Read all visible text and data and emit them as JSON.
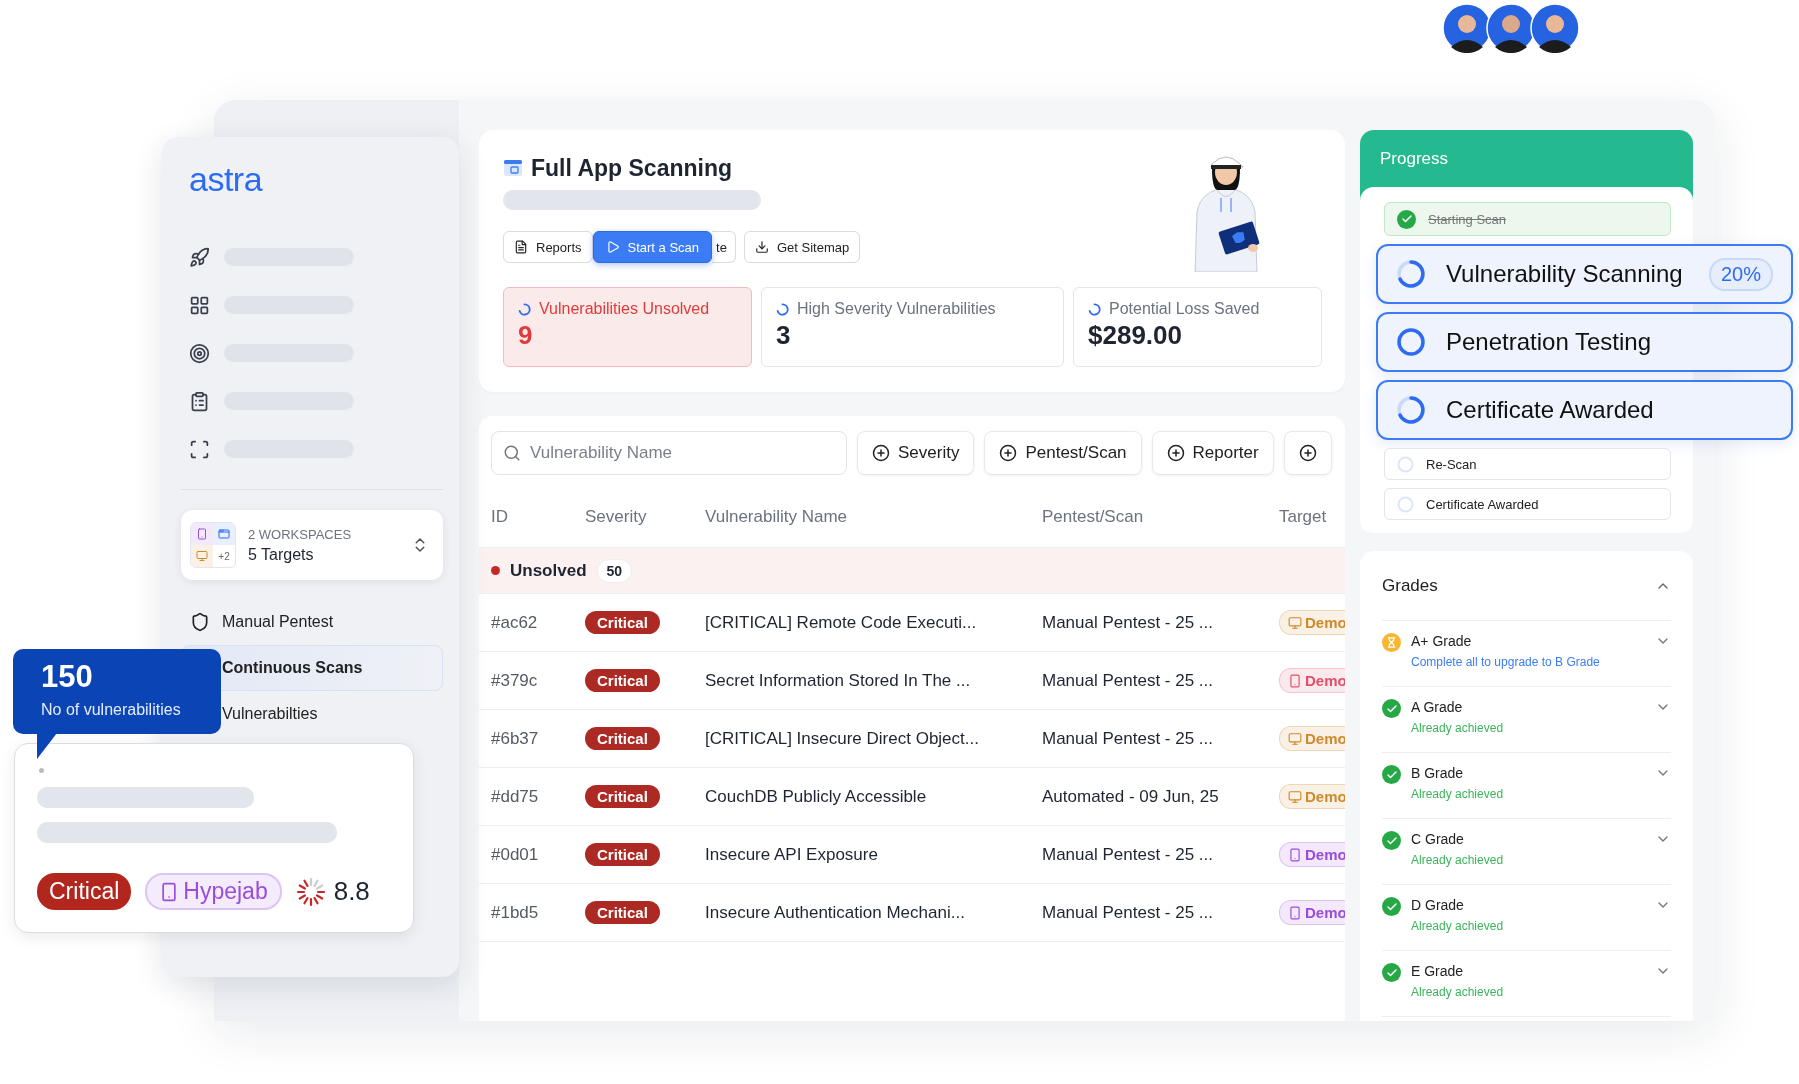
{
  "logo": "astra",
  "workspace": {
    "caption": "2 WORKSPACES",
    "more": "+2",
    "targets": "5 Targets"
  },
  "nav": [
    {
      "label": "Manual Pentest",
      "selected": false
    },
    {
      "label": "Continuous Scans",
      "selected": true
    },
    {
      "label": "Vulnerabilties",
      "selected": false
    }
  ],
  "header": {
    "title": "Full App Scanning",
    "actions": [
      {
        "label": "Reports",
        "kind": "reports"
      },
      {
        "label": "Start a Scan",
        "kind": "primary"
      },
      {
        "label": "te",
        "kind": "partial"
      },
      {
        "label": "Get Sitemap",
        "kind": "download"
      }
    ],
    "stats": [
      {
        "label": "Vulnerabilities Unsolved",
        "value": "9",
        "highlighted": true
      },
      {
        "label": "High Severity Vulnerabilities",
        "value": "3",
        "highlighted": false
      },
      {
        "label": "Potential Loss Saved",
        "value": "$289.00",
        "highlighted": false
      }
    ]
  },
  "filters": {
    "search": {
      "placeholder": "Vulnerability Name"
    },
    "buttons": [
      "Severity",
      "Pentest/Scan",
      "Reporter"
    ]
  },
  "table": {
    "columns": [
      "ID",
      "Severity",
      "Vulnerability Name",
      "Pentest/Scan",
      "Target"
    ],
    "group": {
      "label": "Unsolved",
      "count": "50",
      "color": "#c62828"
    },
    "rows": [
      {
        "id": "#ac62",
        "severity": "Critical",
        "name": "[CRITICAL] Remote Code Executi...",
        "scan": "Manual Pentest - 25 ...",
        "target": {
          "label": "Demo",
          "kind": "desktop",
          "color": "#d08a2c"
        }
      },
      {
        "id": "#379c",
        "severity": "Critical",
        "name": "Secret Information Stored In The ...",
        "scan": "Manual Pentest - 25 ...",
        "target": {
          "label": "Demo",
          "kind": "mobile",
          "color": "#e0506a"
        }
      },
      {
        "id": "#6b37",
        "severity": "Critical",
        "name": "[CRITICAL] Insecure Direct Object...",
        "scan": "Manual Pentest - 25 ...",
        "target": {
          "label": "Demo",
          "kind": "desktop",
          "color": "#d08a2c"
        }
      },
      {
        "id": "#dd75",
        "severity": "Critical",
        "name": "CouchDB Publicly Accessible",
        "scan": "Automated - 09 Jun, 25",
        "target": {
          "label": "Demo",
          "kind": "desktop",
          "color": "#d08a2c"
        }
      },
      {
        "id": "#0d01",
        "severity": "Critical",
        "name": "Insecure API Exposure",
        "scan": "Manual Pentest - 25 ...",
        "target": {
          "label": "Demo",
          "kind": "mobile",
          "color": "#9a4ddb"
        }
      },
      {
        "id": "#1bd5",
        "severity": "Critical",
        "name": "Insecure Authentication Mechani...",
        "scan": "Manual Pentest - 25 ...",
        "target": {
          "label": "Demo",
          "kind": "mobile",
          "color": "#9a4ddb"
        }
      }
    ]
  },
  "progress": {
    "title": "Progress",
    "steps": [
      {
        "label": "Starting Scan",
        "kind": "done"
      },
      {
        "label": "Vulnerability Scanning",
        "kind": "active",
        "badge": "20%"
      },
      {
        "label": "Penetration Testing",
        "kind": "pending"
      },
      {
        "label": "Certificate Awarded",
        "kind": "active"
      },
      {
        "label": "Re-Scan",
        "kind": "waiting"
      },
      {
        "label": "Certificate Awarded",
        "kind": "waiting"
      }
    ]
  },
  "grades": {
    "title": "Grades",
    "expanded": true,
    "items": [
      {
        "name": "A+ Grade",
        "note": "Complete all to upgrade to B Grade",
        "achieved": false
      },
      {
        "name": "A Grade",
        "note": "Already achieved",
        "achieved": true
      },
      {
        "name": "B Grade",
        "note": "Already achieved",
        "achieved": true
      },
      {
        "name": "C Grade",
        "note": "Already achieved",
        "achieved": true
      },
      {
        "name": "D Grade",
        "note": "Already achieved",
        "achieved": true
      },
      {
        "name": "E Grade",
        "note": "Already achieved",
        "achieved": true
      }
    ]
  },
  "tooltip": {
    "value": "150",
    "label": "No of vulnerabilities"
  },
  "finding": {
    "severity": "Critical",
    "target": "Hypejab",
    "score": "8.8"
  }
}
